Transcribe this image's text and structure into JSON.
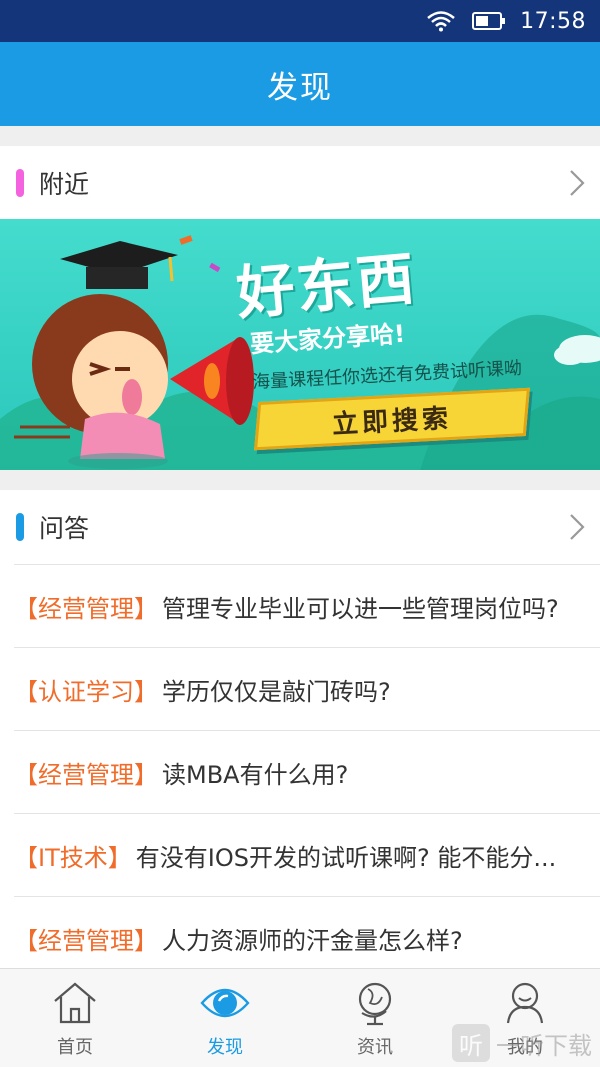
{
  "status_bar": {
    "time": "17:58"
  },
  "header": {
    "title": "发现"
  },
  "nearby": {
    "label": "附近",
    "bar_color": "#f562e0"
  },
  "banner": {
    "headline": "好东西",
    "subline": "要大家分享哈!",
    "desc": "海量课程任你选还有免费试听课呦",
    "cta": "立即搜索"
  },
  "qa": {
    "label": "问答",
    "bar_color": "#1b9be3",
    "items": [
      {
        "tag": "【经营管理】",
        "question": "管理专业毕业可以进一些管理岗位吗?"
      },
      {
        "tag": "【认证学习】",
        "question": "学历仅仅是敲门砖吗?"
      },
      {
        "tag": "【经营管理】",
        "question": "读MBA有什么用?"
      },
      {
        "tag": "【IT技术】",
        "question": "有没有IOS开发的试听课啊? 能不能分..."
      },
      {
        "tag": "【经营管理】",
        "question": "人力资源师的汗金量怎么样?"
      }
    ]
  },
  "tabs": [
    {
      "label": "首页",
      "icon": "home-icon"
    },
    {
      "label": "发现",
      "icon": "eye-icon",
      "active": true
    },
    {
      "label": "资讯",
      "icon": "globe-icon"
    },
    {
      "label": "我的",
      "icon": "user-icon"
    }
  ],
  "watermark": {
    "logo": "听",
    "text": "一听下载"
  },
  "colors": {
    "accent": "#1b9be3",
    "tag": "#f06c2b",
    "banner_bg": "#3fd7c9"
  }
}
